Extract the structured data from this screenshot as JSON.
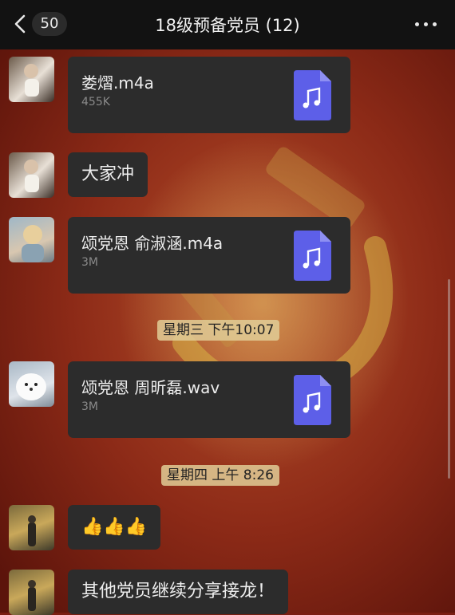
{
  "header": {
    "back_icon": "chevron-left-icon",
    "unread_count": "50",
    "title": "18级预备党员 (12)",
    "more_icon": "more-dots-icon"
  },
  "messages": [
    {
      "kind": "file",
      "avatar": "avatar-user-girl-cat",
      "file_name": "娄熠.m4a",
      "file_size": "455K",
      "icon": "music-file-icon"
    },
    {
      "kind": "text",
      "avatar": "avatar-user-girl-cat",
      "text": "大家冲"
    },
    {
      "kind": "file",
      "avatar": "avatar-user-blonde",
      "file_name": "颂党恩 俞淑涵.m4a",
      "file_size": "3M",
      "icon": "music-file-icon"
    },
    {
      "kind": "timestamp",
      "text": "星期三 下午10:07"
    },
    {
      "kind": "file",
      "avatar": "avatar-user-dog",
      "file_name": "颂党恩 周昕磊.wav",
      "file_size": "3M",
      "icon": "music-file-icon"
    },
    {
      "kind": "timestamp",
      "text": "星期四 上午 8:26"
    },
    {
      "kind": "text",
      "avatar": "avatar-user-autumn",
      "text": "👍👍👍"
    },
    {
      "kind": "text",
      "avatar": "avatar-user-autumn",
      "text": "其他党员继续分享接龙！"
    }
  ],
  "colors": {
    "topbar": "#121212",
    "bubble": "#2c2c2c",
    "file_icon": "#5d5fe8",
    "timestamp_bg": "#e1cd96"
  }
}
